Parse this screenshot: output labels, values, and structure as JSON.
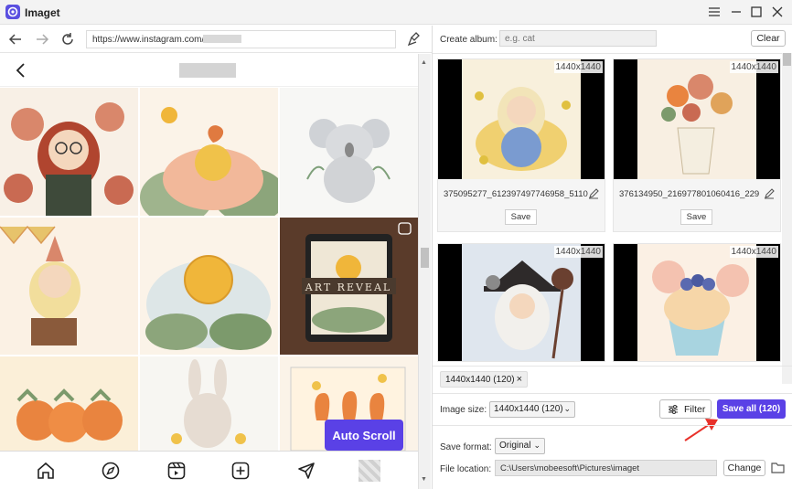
{
  "app": {
    "title": "Imaget"
  },
  "browser": {
    "url": "https://www.instagram.com/"
  },
  "instagram": {
    "profile_name": ""
  },
  "left": {
    "auto_scroll_label": "Auto Scroll"
  },
  "album": {
    "label": "Create album:",
    "placeholder": "e.g. cat",
    "clear_label": "Clear"
  },
  "images": [
    {
      "dim": "1440x1440",
      "filename": "375095277_612397497746958_5110",
      "save": "Save"
    },
    {
      "dim": "1440x1440",
      "filename": "376134950_216977801060416_229",
      "save": "Save"
    },
    {
      "dim": "1440x1440"
    },
    {
      "dim": "1440x1440"
    }
  ],
  "filter_tag": {
    "label": "1440x1440 (120)",
    "close": "×"
  },
  "size": {
    "label": "Image size:",
    "value": "1440x1440 (120)"
  },
  "filter_button": "Filter",
  "save_all": "Save all (120)",
  "format": {
    "label": "Save format:",
    "value": "Original"
  },
  "location": {
    "label": "File location:",
    "value": "C:\\Users\\mobeesoft\\Pictures\\imaget",
    "change": "Change"
  },
  "colors": {
    "accent": "#5a41e6",
    "arrow": "#e8312a"
  }
}
